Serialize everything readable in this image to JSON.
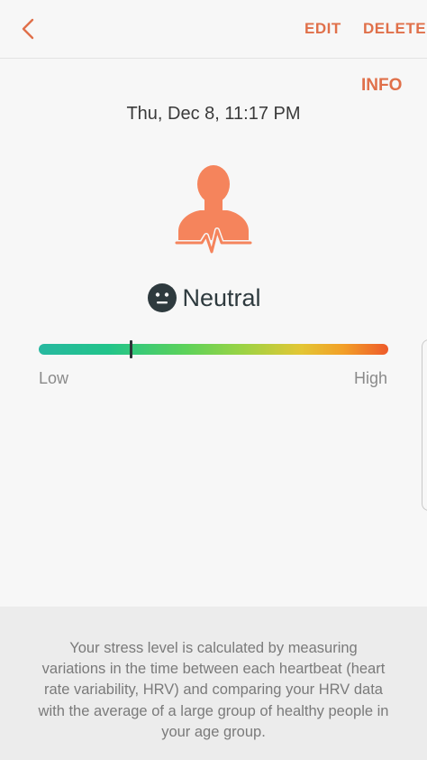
{
  "header": {
    "back_icon": "chevron-left-icon",
    "edit_label": "EDIT",
    "delete_label": "DELETE"
  },
  "info_label": "INFO",
  "record": {
    "datetime": "Thu, Dec 8, 11:17 PM",
    "icon": "person-heartbeat-icon",
    "status_icon": "neutral-face-icon",
    "status": "Neutral",
    "stress_level_fraction": 0.265
  },
  "scale": {
    "low_label": "Low",
    "high_label": "High"
  },
  "description": "Your stress level is calculated by measuring variations in the time between each heartbeat (heart rate variability, HRV) and comparing your HRV data with the average of a large group of healthy people in your age group.",
  "colors": {
    "accent": "#e0704a",
    "icon_orange": "#f5845c",
    "marker": "#2d3538",
    "gradient_start": "#27b8a0",
    "gradient_mid": "#5dd25a",
    "gradient_end": "#ee5a2a"
  }
}
